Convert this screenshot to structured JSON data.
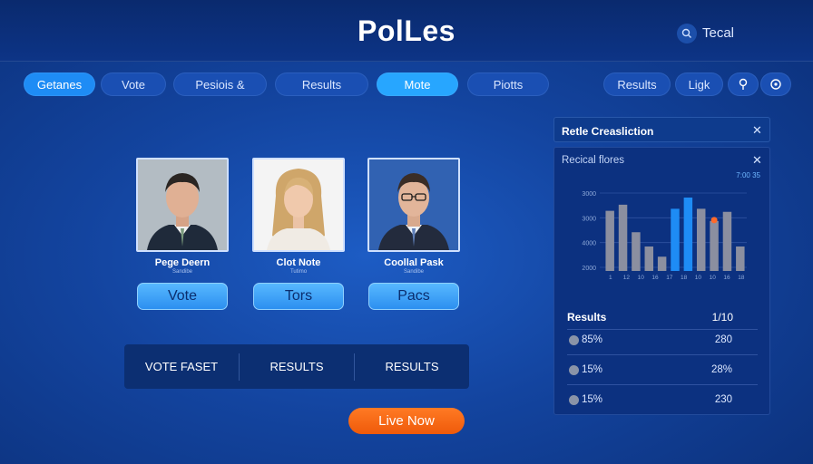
{
  "header": {
    "title": "PolLes",
    "search_label": "Tecal"
  },
  "nav": {
    "items": [
      "Getanes",
      "Vote",
      "Pesiois &",
      "Results",
      "Mote",
      "Piotts"
    ],
    "right_items": [
      "Results",
      "Ligk"
    ],
    "icons": [
      "pin-icon",
      "settings-icon"
    ]
  },
  "candidates": [
    {
      "name": "Pege Deern",
      "subtitle": "Sandibe",
      "button": "Vote"
    },
    {
      "name": "Clot Note",
      "subtitle": "Tutimo",
      "button": "Tors"
    },
    {
      "name": "Coollal Pask",
      "subtitle": "Sandibe",
      "button": "Pacs"
    }
  ],
  "tabs": [
    "VOTE FASET",
    "RESULTS",
    "RESULTS"
  ],
  "live_button": "Live Now",
  "side_panel": {
    "title": "Retle Creasliction",
    "subtitle": "Recical flores",
    "value_tag": "7:00 35",
    "results_label": "Results",
    "results_count": "1/10",
    "rows": [
      {
        "pct": "85%",
        "value": "280"
      },
      {
        "pct": "15%",
        "value": "28%"
      },
      {
        "pct": "15%",
        "value": "230"
      }
    ]
  },
  "chart_data": {
    "type": "bar",
    "title": "",
    "ytick_labels": [
      "3000",
      "3000",
      "4000",
      "2000"
    ],
    "xtick_labels": [
      "1",
      "12",
      "10",
      "16",
      "17",
      "18",
      "10",
      "10",
      "16",
      "18"
    ],
    "values": [
      2950,
      3250,
      1900,
      1200,
      700,
      3050,
      3600,
      3050,
      2450,
      2900,
      1200
    ],
    "colors": [
      "#8b8fa0",
      "#8b8fa0",
      "#8b8fa0",
      "#8b8fa0",
      "#8b8fa0",
      "#1e8cf5",
      "#1e8cf5",
      "#8b8fa0",
      "#8b8fa0",
      "#8b8fa0",
      "#8b8fa0"
    ],
    "marker": {
      "index": 8,
      "color": "#ff6a2a"
    },
    "ylim": [
      0,
      4000
    ],
    "grid": true
  }
}
